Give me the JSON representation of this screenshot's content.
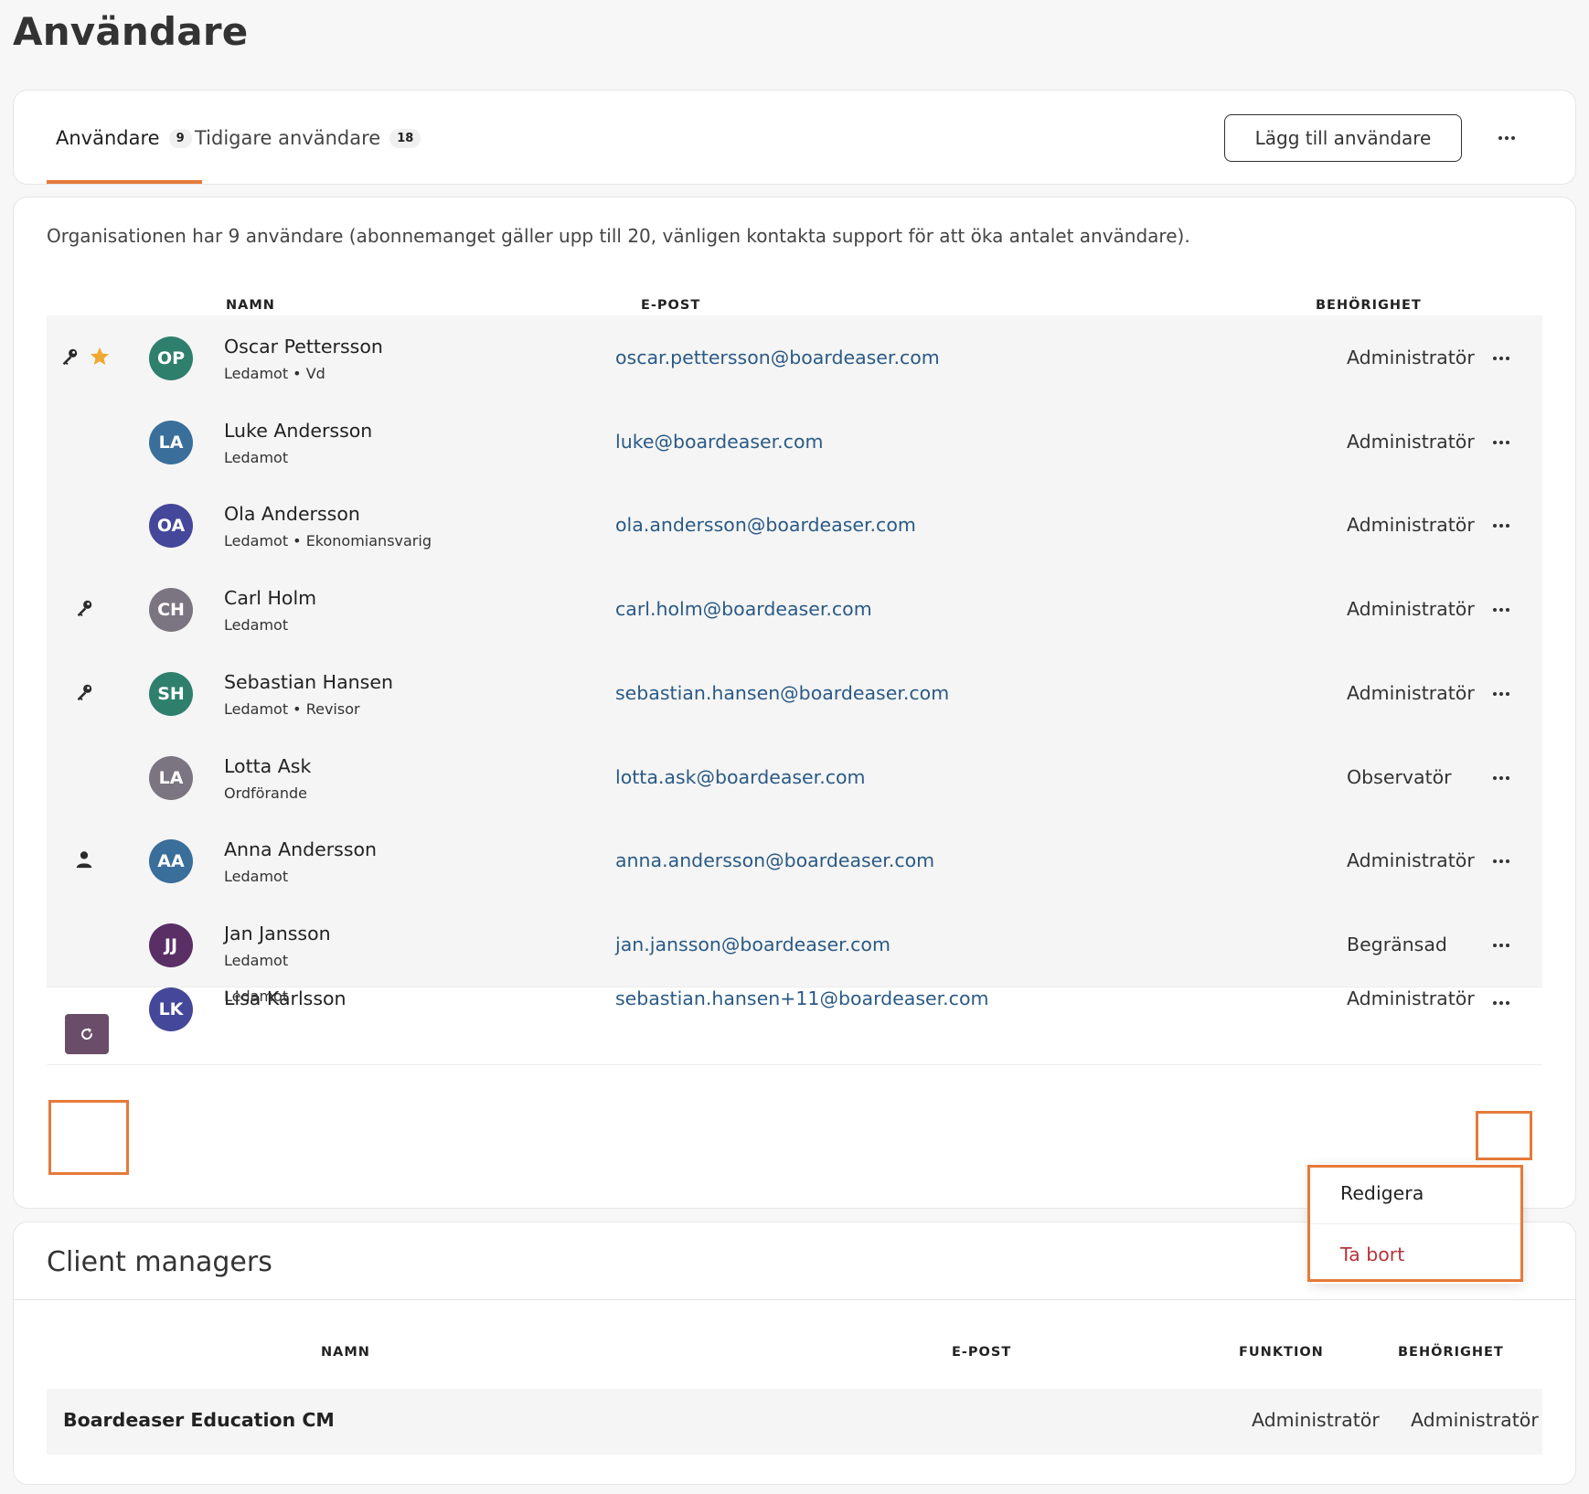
{
  "page": {
    "title": "Användare"
  },
  "tabs": [
    {
      "label": "Användare",
      "count": "9"
    },
    {
      "label": "Tidigare användare",
      "count": "18"
    }
  ],
  "toolbar": {
    "add_user_label": "Lägg till användare"
  },
  "users_section": {
    "info": "Organisationen har 9 användare (abonnemanget gäller upp till 20, vänligen kontakta support för att öka antalet användare).",
    "columns": {
      "name": "NAMN",
      "email": "E-POST",
      "permission": "BEHÖRIGHET"
    },
    "rows": [
      {
        "initials": "OP",
        "avatar_color": "#2f7f6d",
        "name": "Oscar Pettersson",
        "role": "Ledamot • Vd",
        "email": "oscar.pettersson@boardeaser.com",
        "permission": "Administratör",
        "icons": [
          "key-icon",
          "star-icon"
        ]
      },
      {
        "initials": "LA",
        "avatar_color": "#3a6e9b",
        "name": "Luke Andersson",
        "role": "Ledamot",
        "email": "luke@boardeaser.com",
        "permission": "Administratör",
        "icons": []
      },
      {
        "initials": "OA",
        "avatar_color": "#45479a",
        "name": "Ola Andersson",
        "role": "Ledamot • Ekonomiansvarig",
        "email": "ola.andersson@boardeaser.com",
        "permission": "Administratör",
        "icons": []
      },
      {
        "initials": "CH",
        "avatar_color": "#7a7580",
        "name": "Carl Holm",
        "role": "Ledamot",
        "email": "carl.holm@boardeaser.com",
        "permission": "Administratör",
        "icons": [
          "key-icon"
        ]
      },
      {
        "initials": "SH",
        "avatar_color": "#2f7f6d",
        "name": "Sebastian Hansen",
        "role": "Ledamot • Revisor",
        "email": "sebastian.hansen@boardeaser.com",
        "permission": "Administratör",
        "icons": [
          "key-icon"
        ]
      },
      {
        "initials": "LA",
        "avatar_color": "#7a7580",
        "name": "Lotta Ask",
        "role": "Ordförande",
        "email": "lotta.ask@boardeaser.com",
        "permission": "Observatör",
        "icons": []
      },
      {
        "initials": "AA",
        "avatar_color": "#3a6e9b",
        "name": "Anna Andersson",
        "role": "Ledamot",
        "email": "anna.andersson@boardeaser.com",
        "permission": "Administratör",
        "icons": [
          "person-icon"
        ]
      },
      {
        "initials": "JJ",
        "avatar_color": "#5a2f66",
        "name": "Jan Jansson",
        "role": "Ledamot",
        "email": "jan.jansson@boardeaser.com",
        "permission": "Begränsad",
        "icons": []
      },
      {
        "initials": "LK",
        "avatar_color": "#45479a",
        "name": "Lisa Karlsson",
        "role": "Ledamot",
        "email": "sebastian.hansen+11@boardeaser.com",
        "permission": "Administratör",
        "icons": [
          "refresh-icon"
        ]
      }
    ]
  },
  "row_menu": {
    "edit": "Redigera",
    "delete": "Ta bort"
  },
  "client_managers": {
    "title": "Client managers",
    "columns": {
      "name": "NAMN",
      "email": "E-POST",
      "function": "FUNKTION",
      "permission": "BEHÖRIGHET"
    },
    "rows": [
      {
        "name": "Boardeaser Education CM",
        "email": "",
        "function": "Administratör",
        "permission": "Administratör"
      }
    ]
  },
  "colors": {
    "accent": "#e57a3a",
    "link": "#2a5a86",
    "danger": "#b5333a",
    "star": "#f0a830"
  }
}
